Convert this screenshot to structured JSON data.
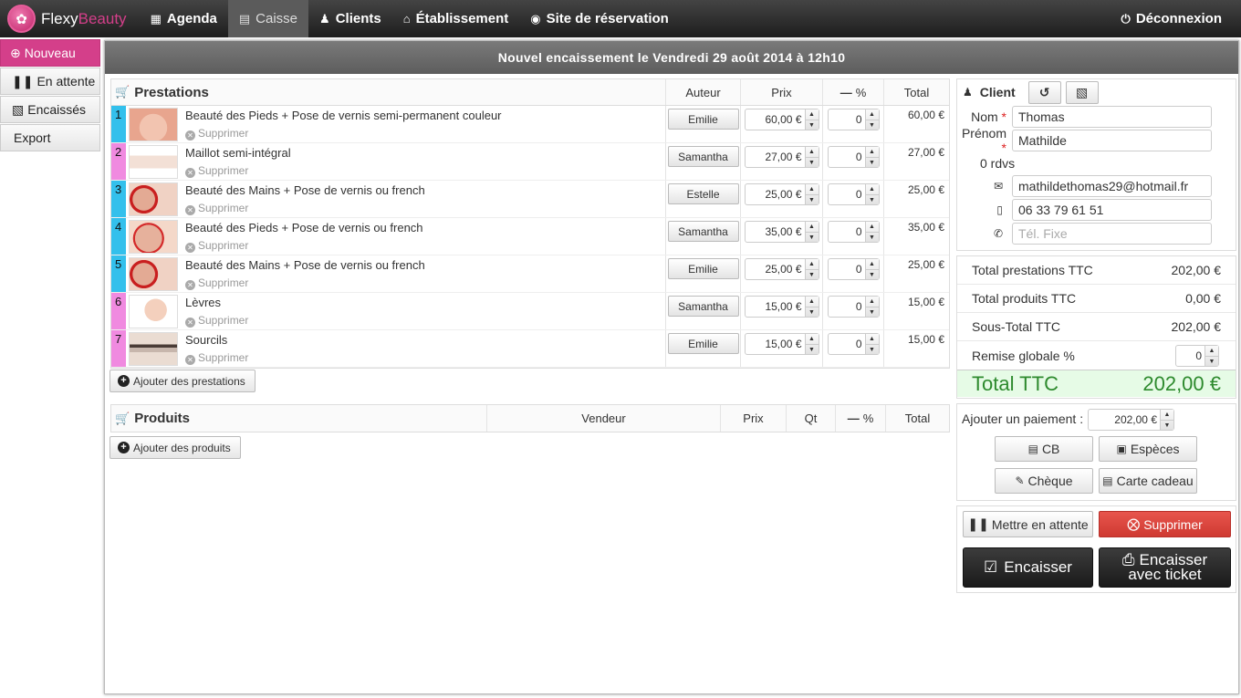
{
  "app": {
    "logo_part1": "Flexy",
    "logo_part2": "Beauty",
    "nav": {
      "agenda": "Agenda",
      "caisse": "Caisse",
      "clients": "Clients",
      "etablissement": "Établissement",
      "reservation": "Site de réservation",
      "logout": "Déconnexion"
    }
  },
  "sidebar": {
    "nouveau": "Nouveau",
    "attente": "En attente",
    "encaisses": "Encaissés",
    "export": "Export"
  },
  "title": "Nouvel encaissement le Vendredi 29 août 2014 à 12h10",
  "prestations": {
    "header": {
      "name": "Prestations",
      "auteur": "Auteur",
      "prix": "Prix",
      "remise": "%",
      "total": "Total"
    },
    "delete_label": "Supprimer",
    "rows": [
      {
        "num": "1",
        "name": "Beauté des Pieds + Pose de vernis semi-permanent couleur",
        "auteur": "Emilie",
        "prix": "60,00 €",
        "remise": "0",
        "total": "60,00 €"
      },
      {
        "num": "2",
        "name": "Maillot semi-intégral",
        "auteur": "Samantha",
        "prix": "27,00 €",
        "remise": "0",
        "total": "27,00 €"
      },
      {
        "num": "3",
        "name": "Beauté des Mains + Pose de vernis ou french",
        "auteur": "Estelle",
        "prix": "25,00 €",
        "remise": "0",
        "total": "25,00 €"
      },
      {
        "num": "4",
        "name": "Beauté des Pieds + Pose de vernis ou french",
        "auteur": "Samantha",
        "prix": "35,00 €",
        "remise": "0",
        "total": "35,00 €"
      },
      {
        "num": "5",
        "name": "Beauté des Mains + Pose de vernis ou french",
        "auteur": "Emilie",
        "prix": "25,00 €",
        "remise": "0",
        "total": "25,00 €"
      },
      {
        "num": "6",
        "name": "Lèvres",
        "auteur": "Samantha",
        "prix": "15,00 €",
        "remise": "0",
        "total": "15,00 €"
      },
      {
        "num": "7",
        "name": "Sourcils",
        "auteur": "Emilie",
        "prix": "15,00 €",
        "remise": "0",
        "total": "15,00 €"
      }
    ],
    "add_label": "Ajouter des prestations"
  },
  "produits": {
    "header": {
      "name": "Produits",
      "vendeur": "Vendeur",
      "prix": "Prix",
      "qt": "Qt",
      "remise": "%",
      "total": "Total"
    },
    "add_label": "Ajouter des produits"
  },
  "client": {
    "title": "Client",
    "nom_label": "Nom",
    "nom": "Thomas",
    "prenom_label": "Prénom",
    "prenom": "Mathilde",
    "rdvs": "0 rdvs",
    "email": "mathildethomas29@hotmail.fr",
    "mobile": "06 33 79 61 51",
    "tel_placeholder": "Tél. Fixe"
  },
  "summary": {
    "prestations_label": "Total prestations TTC",
    "prestations_value": "202,00 €",
    "produits_label": "Total produits TTC",
    "produits_value": "0,00 €",
    "soustotal_label": "Sous-Total TTC",
    "soustotal_value": "202,00 €",
    "remise_label": "Remise globale %",
    "remise_value": "0",
    "total_label": "Total TTC",
    "total_value": "202,00 €"
  },
  "payment": {
    "label": "Ajouter un paiement :",
    "amount": "202,00 €",
    "cb": "CB",
    "especes": "Espèces",
    "cheque": "Chèque",
    "cadeau": "Carte cadeau"
  },
  "actions": {
    "attente": "Mettre en attente",
    "supprimer": "Supprimer",
    "encaisser": "Encaisser",
    "encaisser_ticket_1": "Encaisser",
    "encaisser_ticket_2": "avec ticket"
  },
  "colors": {
    "brand_pink": "#d43f8a",
    "num_blue": "#33c0ec",
    "num_pink": "#f08ae0",
    "danger": "#d9413a",
    "total_green": "#2d8a2d"
  }
}
